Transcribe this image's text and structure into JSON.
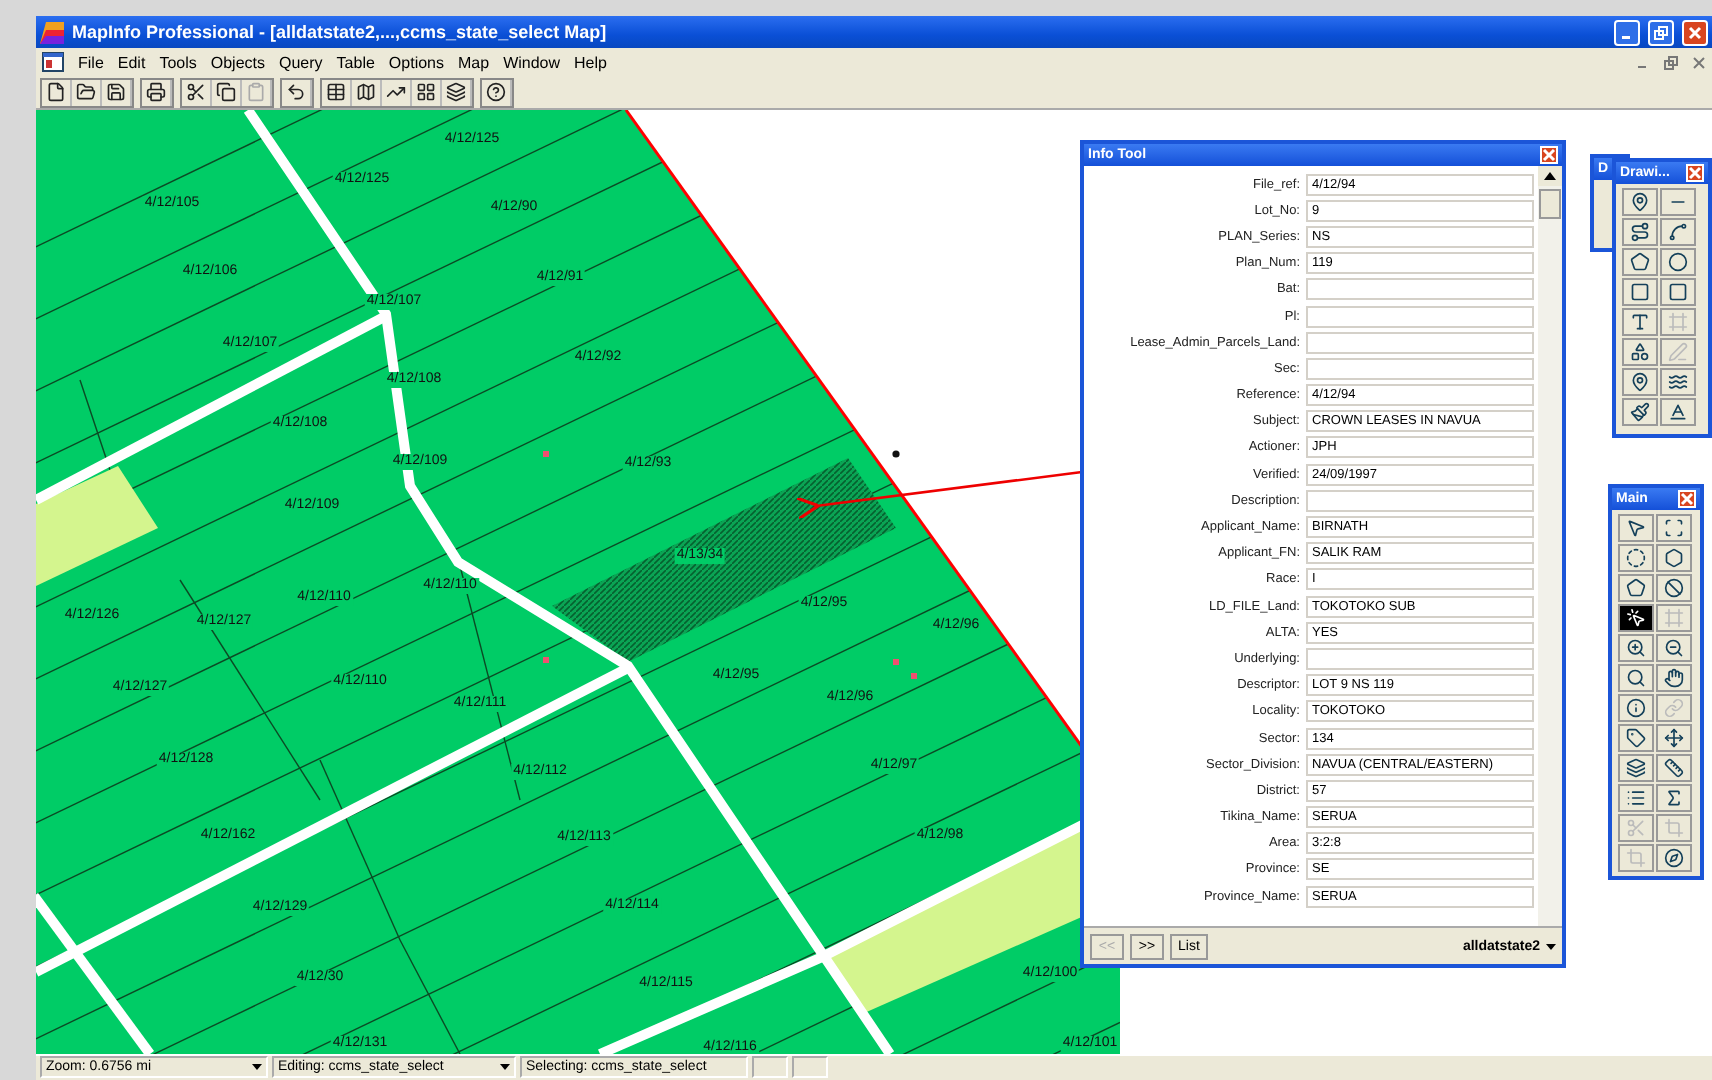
{
  "window": {
    "title": "MapInfo Professional - [alldatstate2,...,ccms_state_select Map]"
  },
  "menu": [
    "File",
    "Edit",
    "Tools",
    "Objects",
    "Query",
    "Table",
    "Options",
    "Map",
    "Window",
    "Help"
  ],
  "toolbar": [
    {
      "disabled": false
    },
    {
      "disabled": false
    },
    {
      "disabled": false
    },
    {
      "disabled": false
    },
    {
      "disabled": false
    },
    {
      "disabled": false
    },
    {
      "disabled": true
    },
    {
      "disabled": false
    },
    {
      "disabled": false
    },
    {
      "disabled": false
    },
    {
      "disabled": false
    },
    {
      "disabled": false
    },
    {
      "disabled": false
    },
    {
      "disabled": false
    }
  ],
  "map": {
    "parcel_labels": [
      "4/12/125",
      "4/12/125",
      "4/12/105",
      "4/12/90",
      "4/12/106",
      "4/12/91",
      "4/12/107",
      "4/12/107",
      "4/12/92",
      "4/12/108",
      "4/12/108",
      "4/12/109",
      "4/12/93",
      "4/12/109",
      "4/13/34",
      "4/12/110",
      "4/12/126",
      "4/12/110",
      "4/12/127",
      "4/12/95",
      "4/12/96",
      "4/12/127",
      "4/12/110",
      "4/12/111",
      "4/12/95",
      "4/12/96",
      "4/12/128",
      "4/12/112",
      "4/12/97",
      "4/12/162",
      "4/12/113",
      "4/12/98",
      "4/12/129",
      "4/12/114",
      "4/12/30",
      "4/12/115",
      "4/12/100",
      "4/12/131",
      "4/12/116",
      "4/12/101"
    ]
  },
  "info_tool": {
    "title": "Info Tool",
    "fields": [
      {
        "label": "File_ref:",
        "value": "4/12/94"
      },
      {
        "label": "Lot_No:",
        "value": "9"
      },
      {
        "label": "PLAN_Series:",
        "value": "NS"
      },
      {
        "label": "Plan_Num:",
        "value": "119"
      },
      {
        "label": "Bat:"
      },
      {
        "label": "Pl:"
      },
      {
        "label": "Lease_Admin_Parcels_Land:"
      },
      {
        "label": "Sec:"
      },
      {
        "label": "Reference:",
        "value": "4/12/94"
      },
      {
        "label": "Subject:",
        "value": "CROWN LEASES IN NAVUA"
      },
      {
        "label": "Actioner:",
        "value": "JPH"
      },
      {
        "label": "Verified:",
        "value": "24/09/1997"
      },
      {
        "label": "Description:"
      },
      {
        "label": "Applicant_Name:",
        "value": "BIRNATH"
      },
      {
        "label": "Applicant_FN:",
        "value": "SALIK RAM"
      },
      {
        "label": "Race:",
        "value": "I"
      },
      {
        "label": "LD_FILE_Land:",
        "value": "TOKOTOKO SUB"
      },
      {
        "label": "ALTA:",
        "value": "YES"
      },
      {
        "label": "Underlying:"
      },
      {
        "label": "Descriptor:",
        "value": "LOT 9 NS 119"
      },
      {
        "label": "Locality:",
        "value": "TOKOTOKO"
      },
      {
        "label": "Sector:",
        "value": "134"
      },
      {
        "label": "Sector_Division:",
        "value": "NAVUA (CENTRAL/EASTERN)"
      },
      {
        "label": "District:",
        "value": "57"
      },
      {
        "label": "Tikina_Name:",
        "value": "SERUA"
      },
      {
        "label": "Area:",
        "value": "3:2:8"
      },
      {
        "label": "Province:",
        "value": "SE"
      },
      {
        "label": "Province_Name:",
        "value": "SERUA"
      }
    ],
    "buttons": [
      {
        "label": "<<",
        "disabled": true
      },
      {
        "label": ">>",
        "disabled": false
      },
      {
        "label": "List",
        "disabled": false
      }
    ],
    "table": "alldatstate2"
  },
  "hidden_toolbar": {
    "title": "D"
  },
  "drawing_toolbar": {
    "title": "Drawi...",
    "buttons": [
      {
        "disabled": false
      },
      {
        "disabled": false
      },
      {
        "disabled": false
      },
      {
        "disabled": false
      },
      {
        "disabled": false
      },
      {
        "disabled": false
      },
      {
        "disabled": false
      },
      {
        "disabled": false
      },
      {
        "disabled": false
      },
      {
        "disabled": true
      },
      {
        "disabled": false
      },
      {
        "disabled": true
      },
      {
        "disabled": false
      },
      {
        "disabled": false
      },
      {
        "disabled": false
      },
      {
        "disabled": false
      }
    ]
  },
  "main_toolbar": {
    "title": "Main",
    "buttons": [
      {
        "disabled": false
      },
      {
        "disabled": false
      },
      {
        "disabled": false
      },
      {
        "disabled": false
      },
      {
        "disabled": false
      },
      {
        "disabled": false
      },
      {
        "disabled": false
      },
      {
        "disabled": true
      },
      {
        "disabled": false
      },
      {
        "disabled": false
      },
      {
        "disabled": false
      },
      {
        "disabled": false
      },
      {
        "disabled": false
      },
      {
        "disabled": true
      },
      {
        "disabled": false
      },
      {
        "disabled": false
      },
      {
        "disabled": false
      },
      {
        "disabled": false
      },
      {
        "disabled": false
      },
      {
        "disabled": false
      },
      {
        "disabled": true
      },
      {
        "disabled": true
      },
      {
        "disabled": true
      },
      {
        "disabled": false
      }
    ]
  },
  "status_bar": [
    {
      "text": "Zoom: 0.6756 mi",
      "dropdown": true
    },
    {
      "text": "Editing: ccms_state_select",
      "dropdown": true
    },
    {
      "text": "Selecting: ccms_state_select",
      "dropdown": false
    },
    {
      "dropdown": false
    },
    {
      "dropdown": false
    }
  ]
}
